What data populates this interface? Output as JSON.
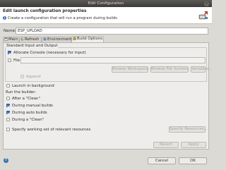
{
  "window": {
    "title": "Edit Configuration",
    "close_glyph": "×"
  },
  "header": {
    "title": "Edit launch configuration properties",
    "message": "Create a configuration that will run a program during builds",
    "info_glyph": "i"
  },
  "name": {
    "label": "Name:",
    "value": "ESP_UPLOAD"
  },
  "tabs": [
    {
      "label": "Main",
      "icon": "main-icon"
    },
    {
      "label": "Refresh",
      "icon": "refresh-icon"
    },
    {
      "label": "Environment",
      "icon": "environment-icon"
    },
    {
      "label": "Build Options",
      "icon": "build-options-icon",
      "active": true
    }
  ],
  "io_group": {
    "label": "Standard Input and Output",
    "allocate_console": {
      "label": "Allocate Console (necessary for input)",
      "checked": true
    },
    "file": {
      "label": "File",
      "checked": false,
      "value": ""
    },
    "browse_workspace": "Browse Workspace...",
    "browse_file_system": "Browse File System...",
    "variables": "Variables...",
    "append": {
      "label": "Append",
      "checked": false
    }
  },
  "launch_in_background": {
    "label": "Launch in background",
    "checked": false
  },
  "run_builder": {
    "label": "Run the builder:",
    "after_clean": {
      "label": "After a \"Clean\"",
      "checked": false
    },
    "during_manual": {
      "label": "During manual builds",
      "checked": true
    },
    "during_auto": {
      "label": "During auto builds",
      "checked": true
    },
    "during_clean": {
      "label": "During a \"Clean\"",
      "checked": false
    }
  },
  "working_set": {
    "label": "Specify working set of relevant resources",
    "checked": false,
    "button": "Specify Resources..."
  },
  "panel_buttons": {
    "revert": "Revert",
    "apply": "Apply"
  },
  "dialog_buttons": {
    "cancel": "Cancel",
    "ok": "OK",
    "help_glyph": "?"
  },
  "colors": {
    "accent": "#3f6fb4",
    "titlebar": "#3c3b37",
    "background": "#dcdad5"
  }
}
